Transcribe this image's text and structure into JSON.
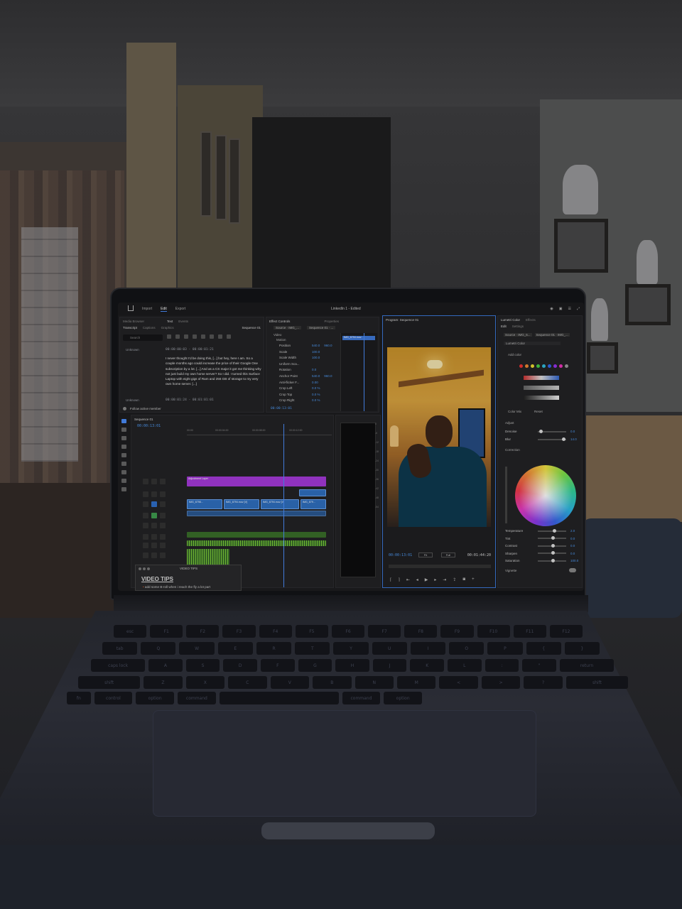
{
  "app": {
    "topbar": {
      "nav": [
        "Import",
        "Edit",
        "Export"
      ],
      "active": "Edit",
      "document_title": "LinkedIn 1 - Edited"
    },
    "text_panel": {
      "tabs": [
        "Media Browser",
        "Text",
        "Events"
      ],
      "subtabs": [
        "Transcript",
        "Captions",
        "Graphics"
      ],
      "sequence": "Sequence 01",
      "search_placeholder": "Search",
      "entries": [
        {
          "speaker": "Unknown",
          "timecode": "00:00:00:03 - 00:00:01:21",
          "text": "I never thought I'd be doing this, [...] but hey, here I am. So a couple months ago could increase the price of their Google One subscription by a lot. [...] And as a CS major it got me thinking why not just build my own home server? So I did. I turned this Surface Laptop with eight gigs of Ram and 256 GB of storage to my very own home server. [...]"
        },
        {
          "speaker": "Unknown",
          "timecode": "00:00:01:24 - 00:01:01:01",
          "text": ""
        }
      ],
      "follow_label": "Follow active member"
    },
    "effect_controls": {
      "tabs": [
        "Effect Controls",
        "Properties"
      ],
      "source": "Source · IMG_...",
      "sequence": "Sequence 01 · ...",
      "clip_name": "IMG_6794.mov",
      "section_video": "Video",
      "section_motion": "Motion",
      "params": [
        {
          "name": "Position",
          "value": "540.0",
          "value2": "960.0"
        },
        {
          "name": "Scale",
          "value": "100.0"
        },
        {
          "name": "Scale Width",
          "value": "100.0"
        },
        {
          "name": "Uniform Sca...",
          "value": ""
        },
        {
          "name": "Rotation",
          "value": "0.0"
        },
        {
          "name": "Anchor Point",
          "value": "540.0",
          "value2": "960.0"
        },
        {
          "name": "Anti-flicker F...",
          "value": "0.00"
        },
        {
          "name": "Crop Left",
          "value": "0.0 %"
        },
        {
          "name": "Crop Top",
          "value": "0.0 %"
        },
        {
          "name": "Crop Right",
          "value": "0.0 %"
        }
      ],
      "timecode": "00:00:13:01"
    },
    "program": {
      "title": "Program: Sequence 01",
      "timecode": "00:00:13:01",
      "fit": "Fit",
      "quality": "Full",
      "duration": "00:01:44:20"
    },
    "timeline": {
      "title": "Sequence 01",
      "timecode": "00:00:13:01",
      "ruler": [
        "00:00",
        "00:00:04:00",
        "00:00:08:00",
        "00:00:12:00"
      ],
      "tracks": [
        "V3",
        "V2",
        "V1",
        "A1",
        "A2",
        "A3",
        "A4",
        "A5"
      ],
      "clips": {
        "purple": "Adjustment Layer",
        "blue": [
          "IMG_6798...",
          "IMG_6794.mov [V]",
          "IMG_6794.mov [V]",
          "IMG_679..."
        ]
      }
    },
    "lumetri": {
      "tabs": [
        "Lumetri Color",
        "Effects"
      ],
      "subtabs": [
        "Edit",
        "Settings"
      ],
      "source": "Source · IMG_6...",
      "sequence": "Sequence 01 · IMG_...",
      "preset": "Lumetri Color",
      "add_color_label": "Add color",
      "color_mix_label": "Color Mix",
      "reset_label": "Reset",
      "section_adjust": "Adjust",
      "light": [
        {
          "name": "Denoise",
          "value": "0.0",
          "pos": 0.05
        },
        {
          "name": "Blur",
          "value": "14.0",
          "pos": 0.9
        }
      ],
      "section_correction": "Correction",
      "correction": [
        {
          "name": "Temperature",
          "value": "2.0",
          "pos": 0.55
        },
        {
          "name": "Tint",
          "value": "0.0",
          "pos": 0.5
        },
        {
          "name": "Contrast",
          "value": "0.0",
          "pos": 0.5
        },
        {
          "name": "Sharpen",
          "value": "0.0",
          "pos": 0.5
        },
        {
          "name": "Saturation",
          "value": "100.0",
          "pos": 0.5
        }
      ],
      "vignette_label": "Vignette",
      "swatch_colors": [
        "#e33",
        "#e83",
        "#ed3",
        "#4c4",
        "#3bd",
        "#36e",
        "#93e",
        "#e3b",
        "#999"
      ]
    },
    "video_tips": {
      "title": "VIDEO TIPS",
      "heading": "VIDEO TIPS",
      "note": "add some B-roll when i reach the fly a lot part"
    }
  },
  "keyboard": {
    "row1": [
      "esc",
      "F1",
      "F2",
      "F3",
      "F4",
      "F5",
      "F6",
      "F7",
      "F8",
      "F9",
      "F10",
      "F11",
      "F12"
    ],
    "row2": [
      "tab",
      "Q",
      "W",
      "E",
      "R",
      "T",
      "Y",
      "U",
      "I",
      "O",
      "P",
      "{",
      "}"
    ],
    "row3": [
      "caps lock",
      "A",
      "S",
      "D",
      "F",
      "G",
      "H",
      "J",
      "K",
      "L",
      ":",
      "\"",
      "return"
    ],
    "row4": [
      "shift",
      "Z",
      "X",
      "C",
      "V",
      "B",
      "N",
      "M",
      "<",
      ">",
      "?",
      "shift"
    ],
    "row5": [
      "fn",
      "control",
      "option",
      "command",
      "",
      "command",
      "option"
    ]
  },
  "colors": {
    "accent": "#4a8cf7",
    "clip_purple": "#a43ad9",
    "clip_blue": "#2f6fbf",
    "audio_green": "#3a6e2a"
  }
}
